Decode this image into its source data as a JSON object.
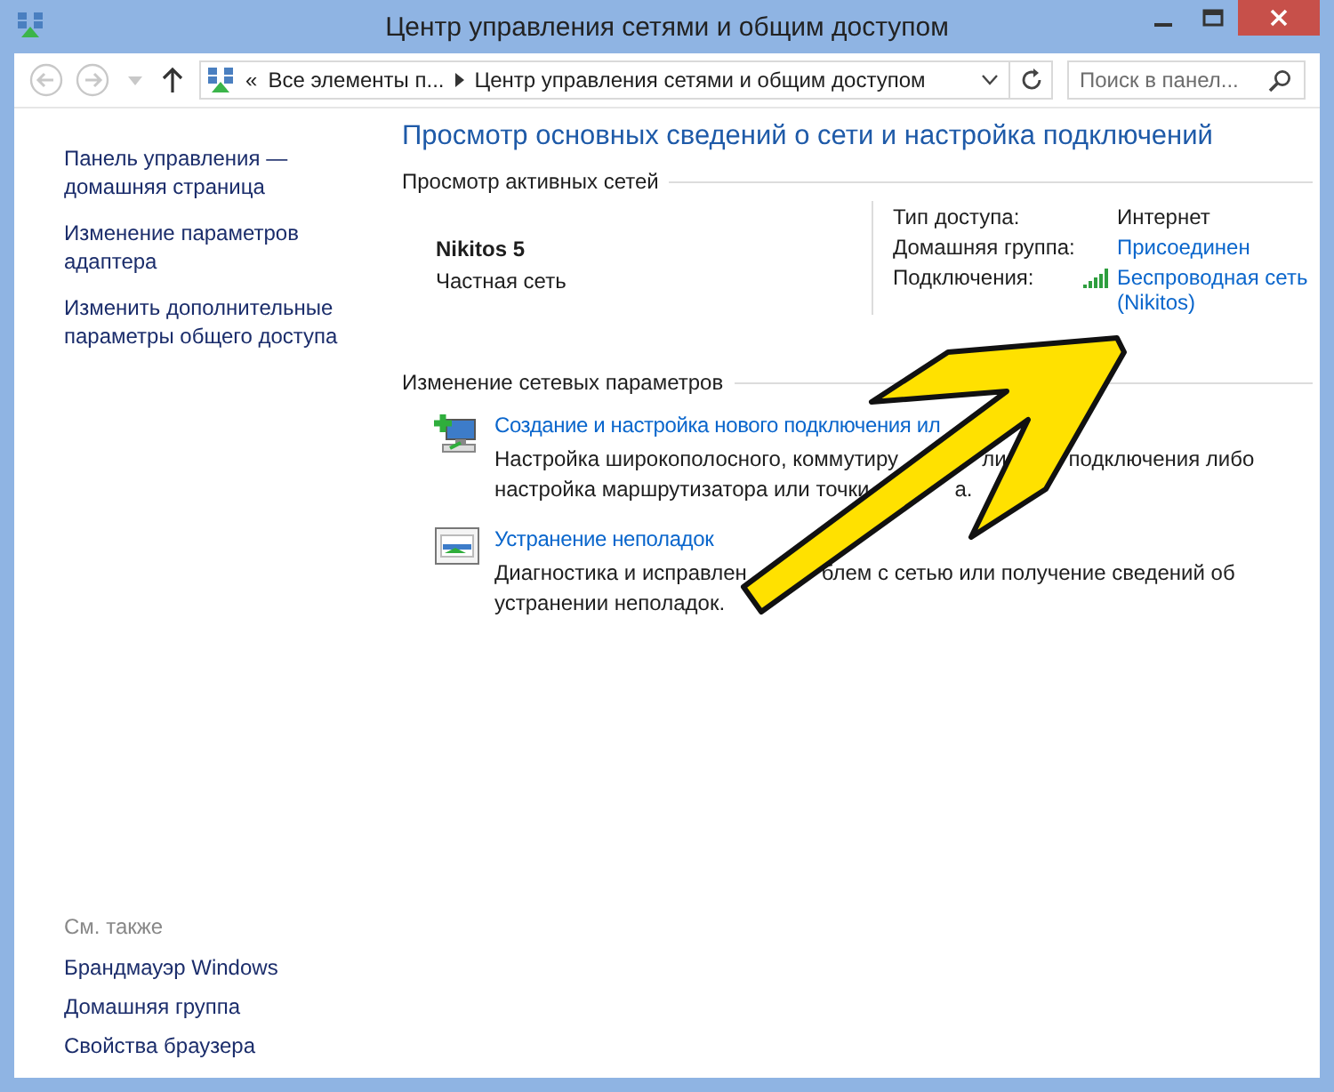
{
  "window": {
    "title": "Центр управления сетями и общим доступом"
  },
  "nav_buttons": [
    {
      "kind": "back",
      "disabled": true
    },
    {
      "kind": "forward",
      "disabled": true
    },
    {
      "kind": "up",
      "disabled": false
    }
  ],
  "address_bar": {
    "prefix": "«",
    "segments": [
      "Все элементы п...",
      "Центр управления сетями и общим доступом"
    ]
  },
  "search": {
    "placeholder": "Поиск в панел..."
  },
  "sidebar": {
    "items": [
      "Панель управления — домашняя страница",
      "Изменение параметров адаптера",
      "Изменить дополнительные параметры общего доступа"
    ],
    "see_also_title": "См. также",
    "see_also": [
      "Брандмауэр Windows",
      "Домашняя группа",
      "Свойства браузера"
    ]
  },
  "main": {
    "heading": "Просмотр основных сведений о сети и настройка подключений",
    "active_networks_title": "Просмотр активных сетей",
    "network": {
      "name": "Nikitos  5",
      "type": "Частная сеть"
    },
    "properties": [
      {
        "label": "Тип доступа:",
        "value": "Интернет",
        "kind": "text"
      },
      {
        "label": "Домашняя группа:",
        "value": "Присоединен",
        "kind": "link"
      },
      {
        "label": "Подключения:",
        "value": "Беспроводная сеть (Nikitos)",
        "kind": "wifi-link"
      }
    ],
    "change_title": "Изменение сетевых параметров",
    "tasks": [
      {
        "kind": "new-connection",
        "link": "Создание и настройка нового подключения ил",
        "description_lines": [
          [
            "Настройка широкополосного, коммутиру",
            "ли",
            "подключения либо"
          ],
          [
            "настройка маршрутизатора или точки",
            "а."
          ]
        ]
      },
      {
        "kind": "troubleshoot",
        "link": "Устранение неполадок",
        "description_lines": [
          [
            "Диагностика и исправлен",
            "блем с сетью или получение сведений об"
          ],
          [
            "устранении неполадок."
          ]
        ]
      }
    ]
  }
}
